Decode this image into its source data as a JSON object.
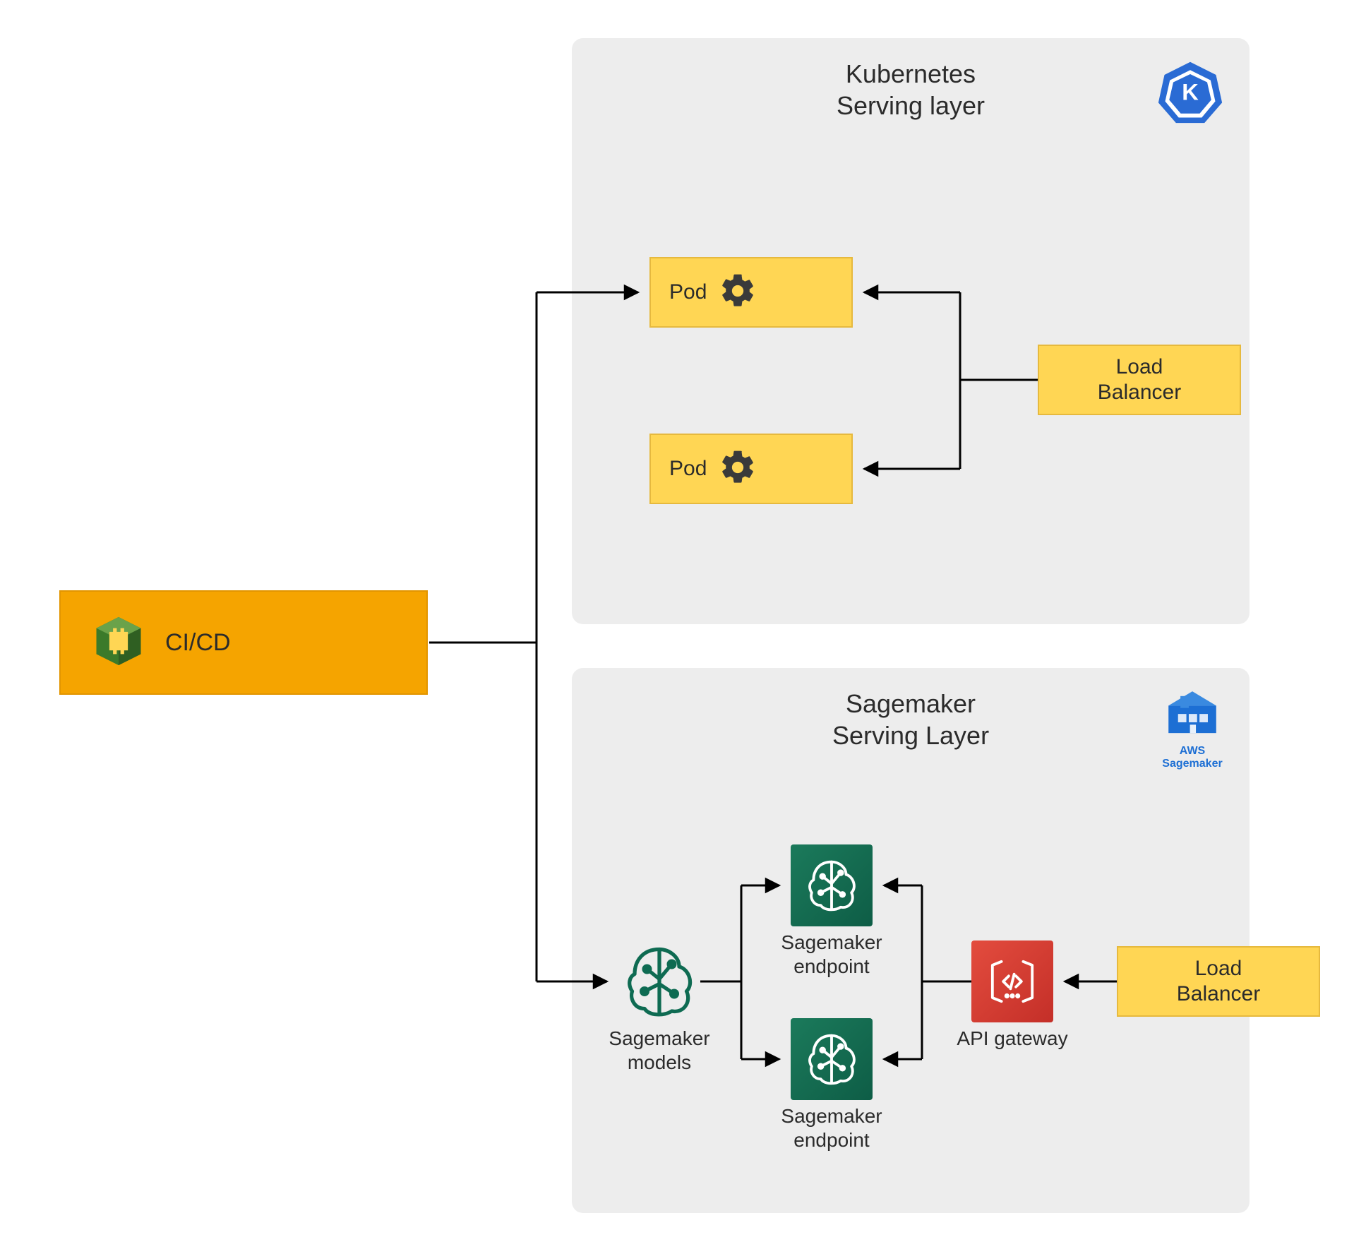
{
  "cicd": {
    "label": "CI/CD"
  },
  "kubernetes_panel": {
    "title_line1": "Kubernetes",
    "title_line2": "Serving layer",
    "pod1_label": "Pod",
    "pod2_label": "Pod",
    "load_balancer_line1": "Load",
    "load_balancer_line2": "Balancer"
  },
  "sagemaker_panel": {
    "title_line1": "Sagemaker",
    "title_line2": "Serving Layer",
    "aws_label_line1": "AWS",
    "aws_label_line2": "Sagemaker",
    "models_caption_line1": "Sagemaker",
    "models_caption_line2": "models",
    "endpoint1_caption_line1": "Sagemaker",
    "endpoint1_caption_line2": "endpoint",
    "endpoint2_caption_line1": "Sagemaker",
    "endpoint2_caption_line2": "endpoint",
    "api_gateway_caption": "API gateway",
    "load_balancer_line1": "Load",
    "load_balancer_line2": "Balancer"
  },
  "colors": {
    "panel_bg": "#ededed",
    "cicd_bg": "#f5a400",
    "yellow_bg": "#ffd654",
    "green_bg": "#18694f",
    "red_bg": "#c9302c",
    "k8s_blue": "#2a6bd4",
    "stroke": "#000000"
  }
}
